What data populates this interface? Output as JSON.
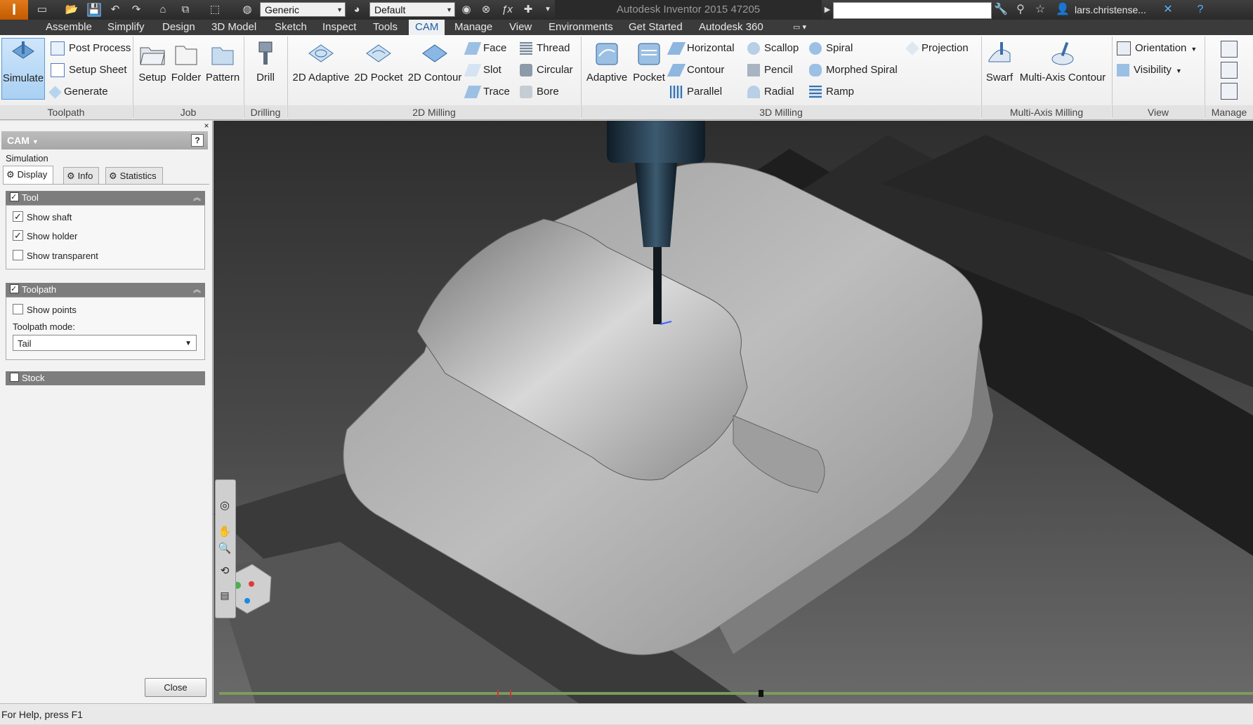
{
  "titlebar": {
    "app_title": "Autodesk Inventor 2015    47205",
    "style_combo": "Generic",
    "appearance_combo": "Default",
    "user": "lars.christense..."
  },
  "ribbon_tabs": [
    "Assemble",
    "Simplify",
    "Design",
    "3D Model",
    "Sketch",
    "Inspect",
    "Tools",
    "CAM",
    "Manage",
    "View",
    "Environments",
    "Get Started",
    "Autodesk 360"
  ],
  "active_tab": "CAM",
  "ribbon": {
    "toolpath": {
      "label": "Toolpath",
      "simulate": "Simulate",
      "post_process": "Post Process",
      "setup_sheet": "Setup Sheet",
      "generate": "Generate"
    },
    "job": {
      "label": "Job",
      "setup": "Setup",
      "folder": "Folder",
      "pattern": "Pattern"
    },
    "drilling": {
      "label": "Drilling",
      "drill": "Drill"
    },
    "milling2d": {
      "label": "2D Milling",
      "adaptive2d": "2D Adaptive",
      "pocket2d": "2D Pocket",
      "contour2d": "2D Contour",
      "face": "Face",
      "slot": "Slot",
      "trace": "Trace",
      "thread": "Thread",
      "circular": "Circular",
      "bore": "Bore"
    },
    "milling3d": {
      "label": "3D Milling",
      "adaptive": "Adaptive",
      "pocket": "Pocket",
      "horizontal": "Horizontal",
      "contour": "Contour",
      "parallel": "Parallel",
      "scallop": "Scallop",
      "pencil": "Pencil",
      "radial": "Radial",
      "spiral": "Spiral",
      "morphed_spiral": "Morphed Spiral",
      "ramp": "Ramp",
      "projection": "Projection"
    },
    "multiaxis": {
      "label": "Multi-Axis Milling",
      "swarf": "Swarf",
      "multi_axis_contour": "Multi-Axis Contour"
    },
    "view": {
      "label": "View",
      "orientation": "Orientation",
      "visibility": "Visibility"
    },
    "manage": {
      "label": "Manage"
    }
  },
  "panel": {
    "title": "CAM",
    "subtitle": "Simulation",
    "tabs": [
      "Display",
      "Info",
      "Statistics"
    ],
    "tool_section": "Tool",
    "show_shaft": "Show shaft",
    "show_holder": "Show holder",
    "show_transparent": "Show transparent",
    "toolpath_section": "Toolpath",
    "show_points": "Show points",
    "toolpath_mode_label": "Toolpath mode:",
    "toolpath_mode_value": "Tail",
    "stock_section": "Stock",
    "close": "Close"
  },
  "status": "For Help, press F1",
  "colors": {
    "accent": "#1d5fa6",
    "brand": "#d96a12",
    "timeline": "#7c9a60"
  }
}
